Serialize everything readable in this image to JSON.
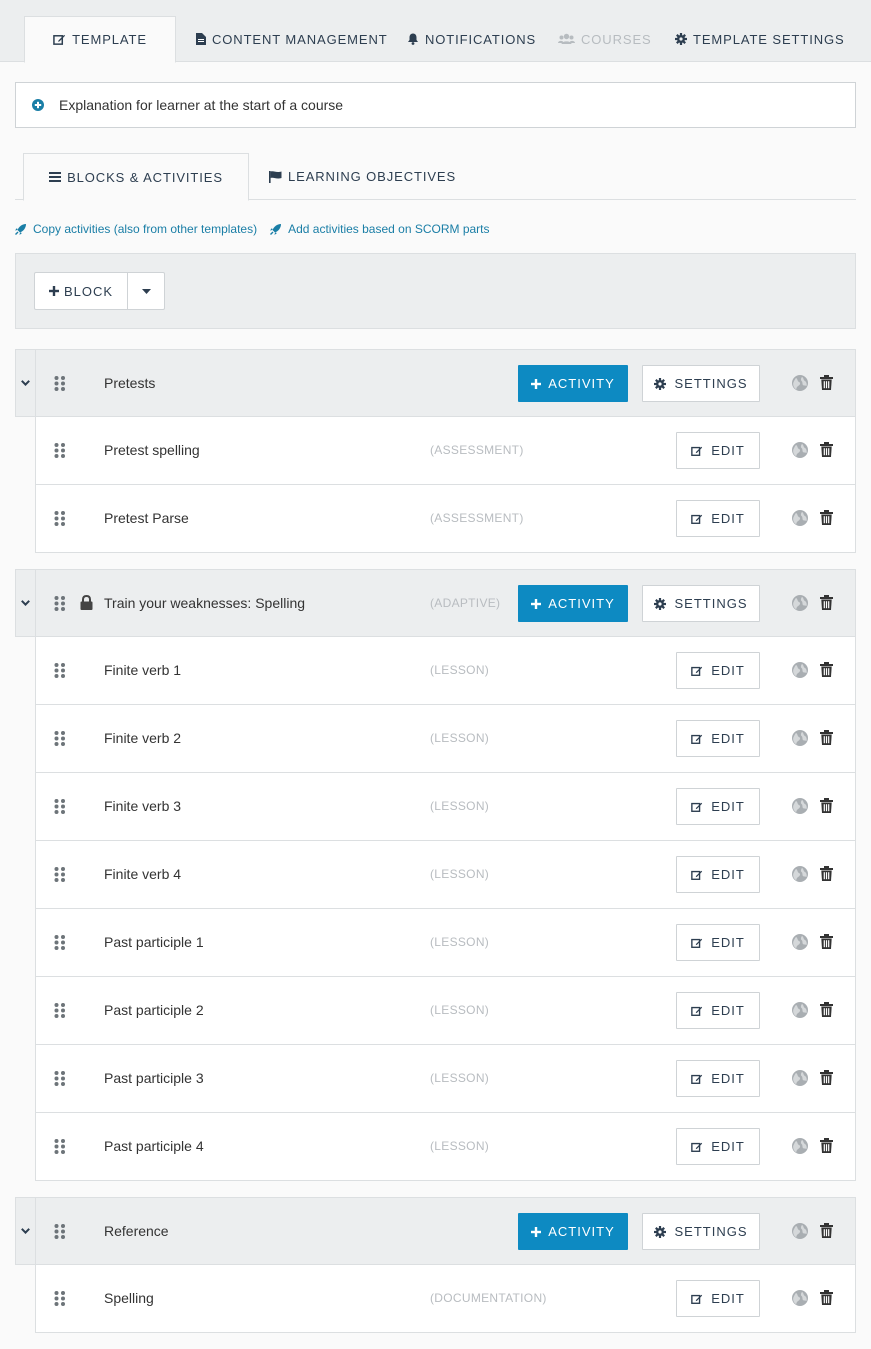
{
  "nav": {
    "tabs": [
      {
        "label": "Template",
        "icon": "edit-icon"
      },
      {
        "label": "Content Management",
        "icon": "file-icon"
      },
      {
        "label": "Notifications",
        "icon": "bell-icon"
      },
      {
        "label": "Courses",
        "icon": "users-icon"
      },
      {
        "label": "Template Settings",
        "icon": "gear-icon"
      }
    ]
  },
  "explanation": {
    "label": "Explanation for learner at the start of a course"
  },
  "subtabs": [
    {
      "label": "Blocks & Activities",
      "icon": "bars-icon"
    },
    {
      "label": "Learning Objectives",
      "icon": "flag-icon"
    }
  ],
  "links": {
    "copy": "Copy activities (also from other templates)",
    "scorm": "Add activities based on SCORM parts"
  },
  "block_button": {
    "label": "BLOCK"
  },
  "buttons": {
    "activity": "ACTIVITY",
    "settings": "SETTINGS",
    "edit": "EDIT"
  },
  "groups": [
    {
      "title": "Pretests",
      "type": "",
      "locked": false,
      "items": [
        {
          "title": "Pretest spelling",
          "type": "(ASSESSMENT)"
        },
        {
          "title": "Pretest Parse",
          "type": "(ASSESSMENT)"
        }
      ]
    },
    {
      "title": "Train your weaknesses: Spelling",
      "type": "(ADAPTIVE)",
      "locked": true,
      "items": [
        {
          "title": "Finite verb 1",
          "type": "(LESSON)"
        },
        {
          "title": "Finite verb 2",
          "type": "(LESSON)"
        },
        {
          "title": "Finite verb 3",
          "type": "(LESSON)"
        },
        {
          "title": "Finite verb 4",
          "type": "(LESSON)"
        },
        {
          "title": "Past participle 1",
          "type": "(LESSON)"
        },
        {
          "title": "Past participle 2",
          "type": "(LESSON)"
        },
        {
          "title": "Past participle 3",
          "type": "(LESSON)"
        },
        {
          "title": "Past participle 4",
          "type": "(LESSON)"
        }
      ]
    },
    {
      "title": "Reference",
      "type": "",
      "locked": false,
      "items": [
        {
          "title": "Spelling",
          "type": "(DOCUMENTATION)"
        }
      ]
    }
  ],
  "colors": {
    "accent": "#0d8ac2",
    "link": "#1a7ea6",
    "header_bg": "#eceeef"
  }
}
